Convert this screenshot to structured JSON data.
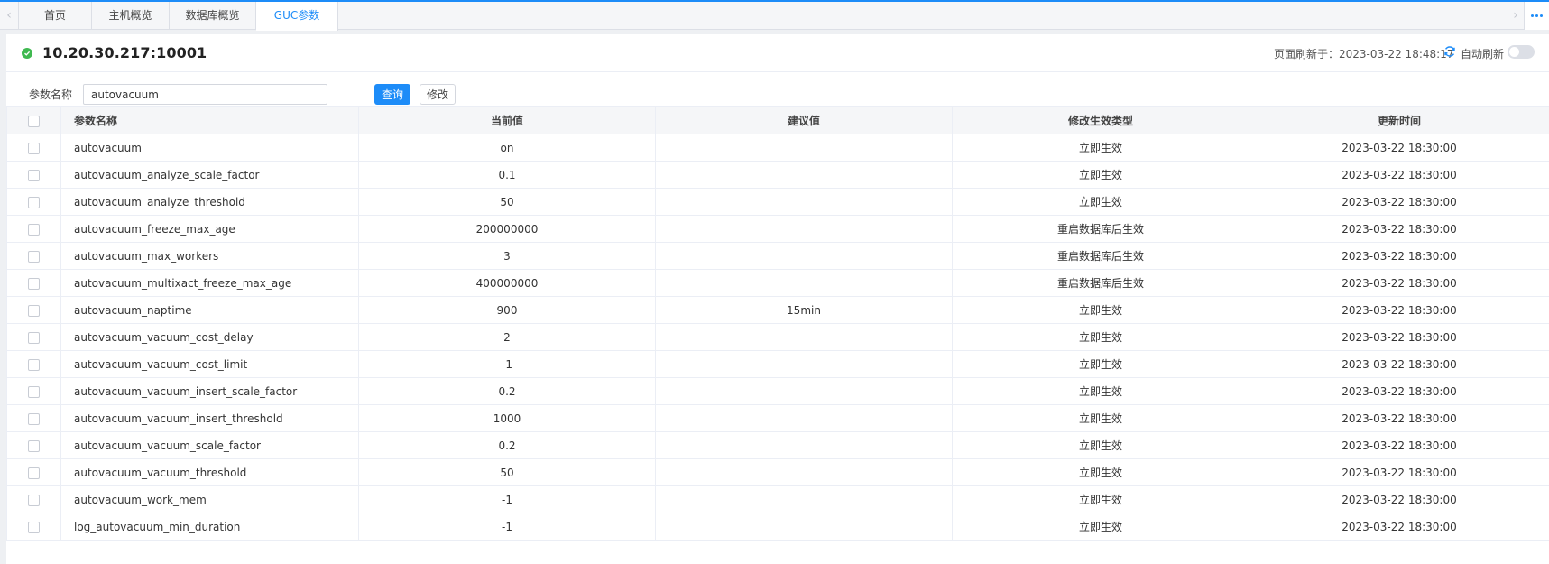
{
  "tabs": [
    {
      "label": "首页",
      "active": false
    },
    {
      "label": "主机概览",
      "active": false
    },
    {
      "label": "数据库概览",
      "active": false
    },
    {
      "label": "GUC参数",
      "active": true
    }
  ],
  "icons": {
    "tab_left": "chevron-left-icon",
    "tab_right": "chevron-right-icon",
    "more": "more-dots-icon",
    "status": "check-circle-icon",
    "refresh": "refresh-icon"
  },
  "colors": {
    "accent": "#1d8cf8",
    "status_ok": "#3fb950"
  },
  "header": {
    "host": "10.20.30.217:10001",
    "refresh_text": "页面刷新于：2023-03-22 18:48:17",
    "auto_refresh_label": "自动刷新",
    "auto_refresh_on": false
  },
  "filter": {
    "label": "参数名称",
    "value": "autovacuum",
    "query_button": "查询",
    "modify_button": "修改"
  },
  "table": {
    "columns": [
      "参数名称",
      "当前值",
      "建议值",
      "修改生效类型",
      "更新时间"
    ],
    "rows": [
      {
        "name": "autovacuum",
        "value": "on",
        "suggested": "",
        "effect": "立即生效",
        "updated": "2023-03-22 18:30:00"
      },
      {
        "name": "autovacuum_analyze_scale_factor",
        "value": "0.1",
        "suggested": "",
        "effect": "立即生效",
        "updated": "2023-03-22 18:30:00"
      },
      {
        "name": "autovacuum_analyze_threshold",
        "value": "50",
        "suggested": "",
        "effect": "立即生效",
        "updated": "2023-03-22 18:30:00"
      },
      {
        "name": "autovacuum_freeze_max_age",
        "value": "200000000",
        "suggested": "",
        "effect": "重启数据库后生效",
        "updated": "2023-03-22 18:30:00"
      },
      {
        "name": "autovacuum_max_workers",
        "value": "3",
        "suggested": "",
        "effect": "重启数据库后生效",
        "updated": "2023-03-22 18:30:00"
      },
      {
        "name": "autovacuum_multixact_freeze_max_age",
        "value": "400000000",
        "suggested": "",
        "effect": "重启数据库后生效",
        "updated": "2023-03-22 18:30:00"
      },
      {
        "name": "autovacuum_naptime",
        "value": "900",
        "suggested": "15min",
        "effect": "立即生效",
        "updated": "2023-03-22 18:30:00"
      },
      {
        "name": "autovacuum_vacuum_cost_delay",
        "value": "2",
        "suggested": "",
        "effect": "立即生效",
        "updated": "2023-03-22 18:30:00"
      },
      {
        "name": "autovacuum_vacuum_cost_limit",
        "value": "-1",
        "suggested": "",
        "effect": "立即生效",
        "updated": "2023-03-22 18:30:00"
      },
      {
        "name": "autovacuum_vacuum_insert_scale_factor",
        "value": "0.2",
        "suggested": "",
        "effect": "立即生效",
        "updated": "2023-03-22 18:30:00"
      },
      {
        "name": "autovacuum_vacuum_insert_threshold",
        "value": "1000",
        "suggested": "",
        "effect": "立即生效",
        "updated": "2023-03-22 18:30:00"
      },
      {
        "name": "autovacuum_vacuum_scale_factor",
        "value": "0.2",
        "suggested": "",
        "effect": "立即生效",
        "updated": "2023-03-22 18:30:00"
      },
      {
        "name": "autovacuum_vacuum_threshold",
        "value": "50",
        "suggested": "",
        "effect": "立即生效",
        "updated": "2023-03-22 18:30:00"
      },
      {
        "name": "autovacuum_work_mem",
        "value": "-1",
        "suggested": "",
        "effect": "立即生效",
        "updated": "2023-03-22 18:30:00"
      },
      {
        "name": "log_autovacuum_min_duration",
        "value": "-1",
        "suggested": "",
        "effect": "立即生效",
        "updated": "2023-03-22 18:30:00"
      }
    ]
  }
}
